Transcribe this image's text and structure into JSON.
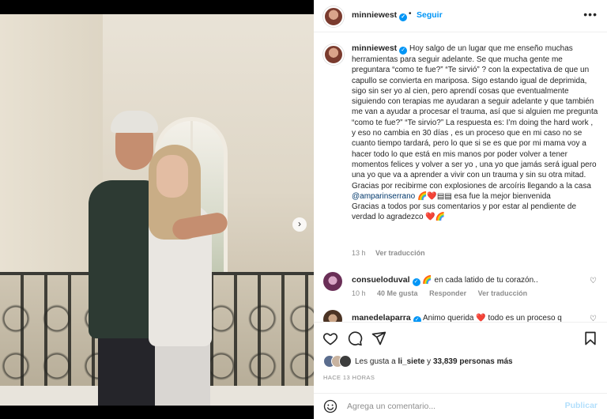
{
  "post": {
    "author": "minniewest",
    "follow_label": "Seguir",
    "bullet": "•",
    "more_icon": "more-horizontal-icon",
    "caption_p1": "Hoy salgo de un lugar que me enseño muchas herramientas para seguir adelante. Se que mucha gente me preguntara “como te fue?” “Te sirvió” ? con la expectativa de que un capullo se convierta en mariposa. Sigo estando igual de deprimida, sigo sin ser yo al cien, pero aprendí cosas que eventualmente siguiendo con terapias me ayudaran a seguir adelante y que también me van a ayudar a procesar el trauma, así que si alguien me pregunta “como te fue?” “Te sirvio?” La respuesta es: I’m doing the hard work , y eso no cambia en 30 días , es un proceso que en mi caso no se cuanto tiempo tardará, pero lo que si se es que por mi mama voy a hacer todo lo que está en mis manos por poder volver a tener momentos felices y volver a ser yo , una yo que jamás será igual pero una yo que va a aprender a vivir con un trauma y sin su otra mitad. Gracias por recibirme con explosiones de arcoíris llegando a la casa ",
    "caption_mention": "@amparinserrano",
    "caption_p2": " 🌈❤️▤▤ esa fue la mejor bienvenida",
    "caption_p3": "Gracias a todos por sus comentarios y por estar al pendiente de verdad lo agradezco ❤️🌈",
    "caption_time": "13 h",
    "see_translation": "Ver traducción",
    "likes_prefix": "Les gusta a ",
    "likes_user": "li_siete",
    "likes_mid": " y ",
    "likes_count": "33,839 personas más",
    "posted_ago": "HACE 13 HORAS",
    "add_comment_placeholder": "Agrega un comentario...",
    "publish_label": "Publicar"
  },
  "comments": [
    {
      "user": "consueloduval",
      "text": "🌈 en cada latido de tu corazón..",
      "time": "10 h",
      "likes": "40 Me gusta",
      "reply": "Responder",
      "translate": "Ver traducción"
    },
    {
      "user": "manedelaparra",
      "text": "Animo querida ❤️ todo es un proceso q"
    }
  ],
  "media": {
    "slide_count": 11,
    "active_slide": 0
  },
  "colors": {
    "accent": "#0095f6",
    "muted": "#8e8e8e",
    "text": "#262626",
    "publish_disabled": "#b2dffc"
  }
}
